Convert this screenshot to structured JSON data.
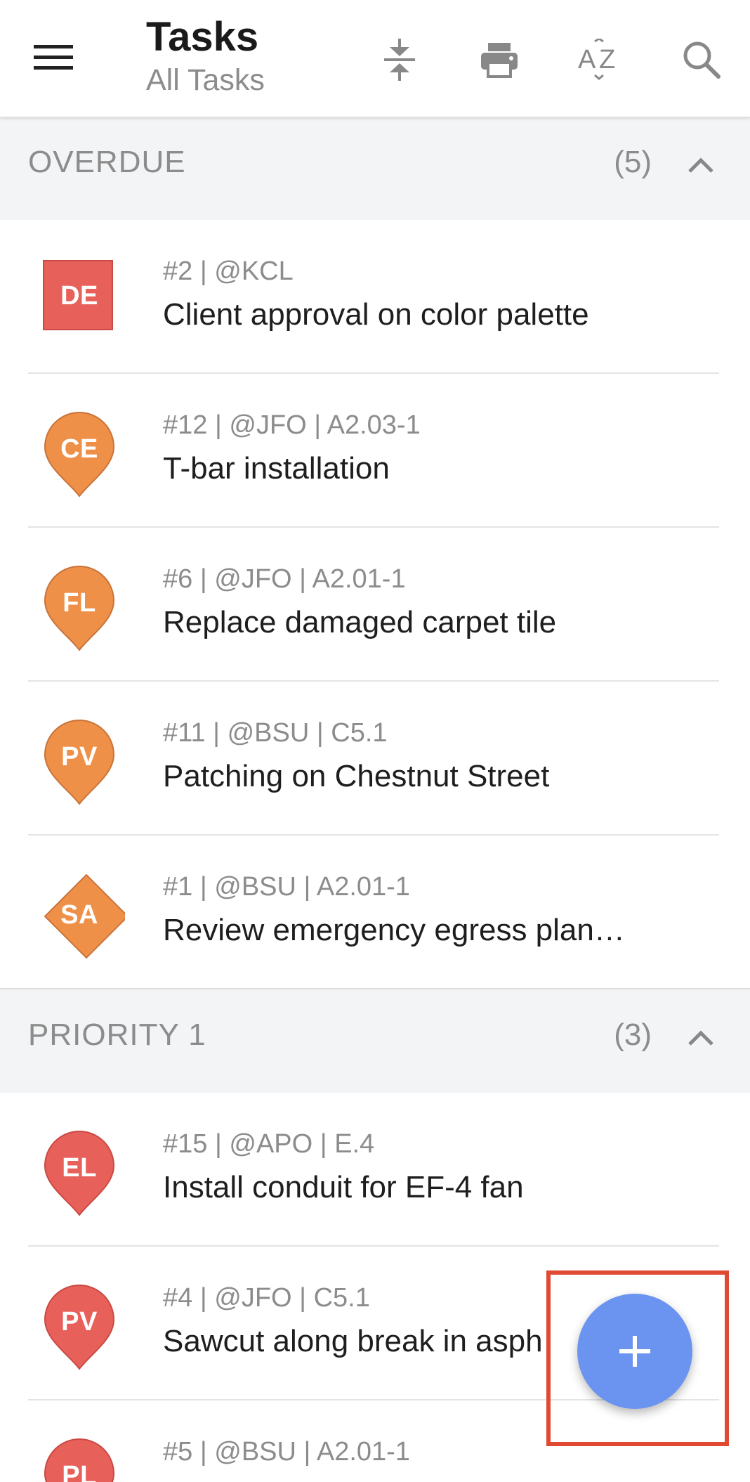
{
  "header": {
    "title": "Tasks",
    "subtitle": "All Tasks",
    "icons": [
      "menu-icon",
      "collapse-icon",
      "print-icon",
      "sort-az-icon",
      "search-icon"
    ]
  },
  "sections": [
    {
      "label": "OVERDUE",
      "count": "(5)",
      "tasks": [
        {
          "initials": "DE",
          "shape": "square",
          "color": "#e8605a",
          "meta": "#2 | @KCL",
          "title": "Client approval on color palette"
        },
        {
          "initials": "CE",
          "shape": "pin",
          "color": "#ef9048",
          "meta": "#12 | @JFO | A2.03-1",
          "title": "T-bar installation"
        },
        {
          "initials": "FL",
          "shape": "pin",
          "color": "#ef9048",
          "meta": "#6 | @JFO | A2.01-1",
          "title": "Replace damaged carpet tile"
        },
        {
          "initials": "PV",
          "shape": "pin",
          "color": "#ef9048",
          "meta": "#11 | @BSU | C5.1",
          "title": "Patching on Chestnut Street"
        },
        {
          "initials": "SA",
          "shape": "diamond",
          "color": "#ef9048",
          "meta": "#1 | @BSU | A2.01-1",
          "title": "Review emergency egress plan…"
        }
      ]
    },
    {
      "label": "PRIORITY 1",
      "count": "(3)",
      "tasks": [
        {
          "initials": "EL",
          "shape": "pin",
          "color": "#e8605a",
          "meta": "#15 | @APO | E.4",
          "title": "Install conduit for EF-4 fan"
        },
        {
          "initials": "PV",
          "shape": "pin",
          "color": "#e8605a",
          "meta": "#4 | @JFO | C5.1",
          "title": "Sawcut along break in asph"
        },
        {
          "initials": "PL",
          "shape": "pin",
          "color": "#e8605a",
          "meta": "#5 | @BSU | A2.01-1",
          "title": ""
        }
      ]
    }
  ],
  "fab": {
    "icon": "plus-icon",
    "color": "#6b93f0"
  },
  "highlight_color": "#e04a32"
}
